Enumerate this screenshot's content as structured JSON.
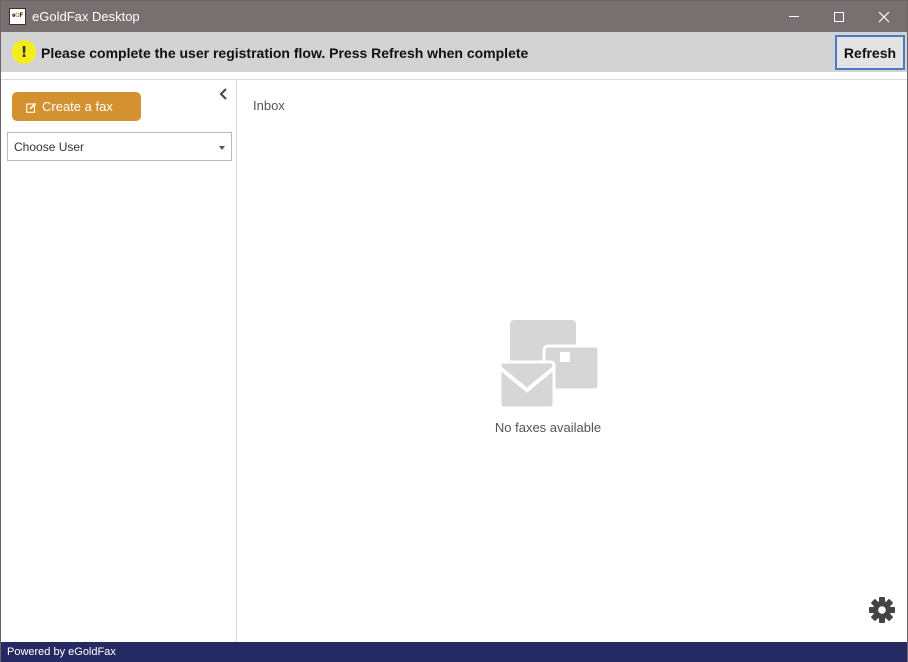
{
  "window": {
    "title": "eGoldFax Desktop",
    "logo_text_prefix": "e",
    "logo_text_accent": "G",
    "logo_text_suffix": "F"
  },
  "notice": {
    "icon": "!",
    "message": "Please complete the user registration flow. Press Refresh when complete",
    "refresh_label": "Refresh"
  },
  "sidebar": {
    "create_fax_label": "Create a fax",
    "user_select": {
      "selected": "Choose User"
    }
  },
  "main": {
    "inbox_label": "Inbox",
    "empty_message": "No faxes available"
  },
  "footer": {
    "text": "Powered by eGoldFax"
  },
  "colors": {
    "titlebar": "#787070",
    "notice_bar": "#d3d3d3",
    "accent": "#d3912f",
    "footer": "#262a63",
    "warning": "#f5ec1f",
    "focus_outline": "#4b79c6"
  },
  "icons": {
    "app": "egoldfax-logo-icon",
    "warning": "exclamation-icon",
    "create": "edit-icon",
    "collapse": "chevron-left-icon",
    "empty": "envelope-icon",
    "settings": "gear-icon"
  }
}
